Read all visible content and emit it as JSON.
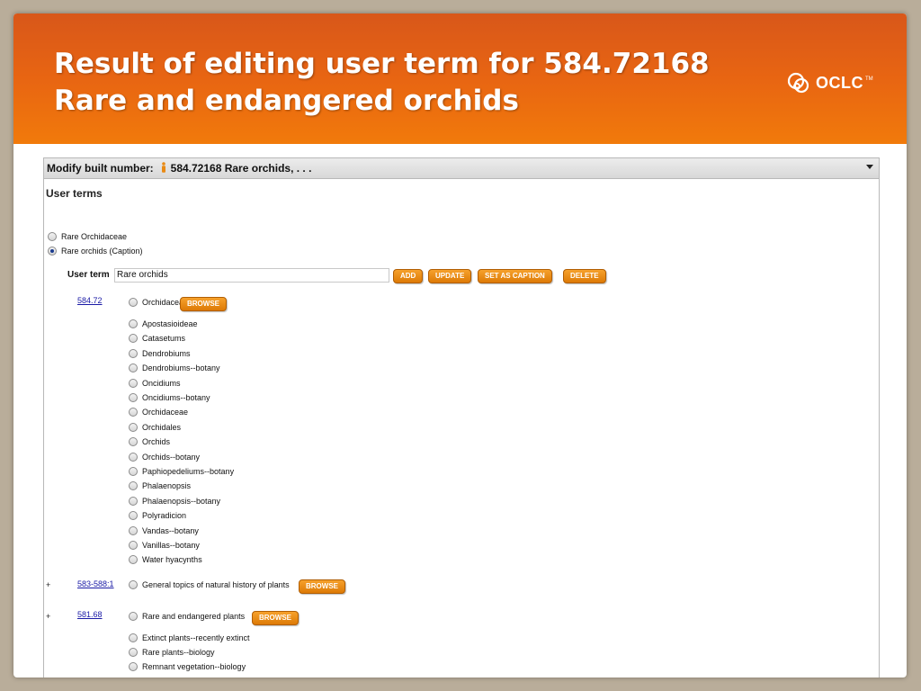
{
  "slide": {
    "title_line1": "Result of editing user term for 584.72168",
    "title_line2": "Rare and endangered orchids",
    "logo_text": "OCLC",
    "logo_tm": "TM"
  },
  "panel": {
    "header_label": "Modify built number:",
    "header_value": "584.72168 Rare orchids, . . .",
    "section_title": "User terms",
    "user_terms": [
      {
        "label": "Rare Orchidaceae",
        "checked": false
      },
      {
        "label": "Rare orchids  (Caption)",
        "checked": true
      }
    ],
    "user_term_label": "User term",
    "user_term_value": "Rare orchids",
    "buttons": {
      "add": "ADD",
      "update": "UPDATE",
      "set_as_caption": "SET AS CAPTION",
      "delete": "DELETE",
      "browse": "BROWSE"
    },
    "groups": [
      {
        "number": "584.72",
        "plus": "",
        "heading": "Orchidaceae",
        "terms": [
          "Apostasioideae",
          "Catasetums",
          "Dendrobiums",
          "Dendrobiums--botany",
          "Oncidiums",
          "Oncidiums--botany",
          "Orchidaceae",
          "Orchidales",
          "Orchids",
          "Orchids--botany",
          "Paphiopedeliums--botany",
          "Phalaenopsis",
          "Phalaenopsis--botany",
          "Polyradicion",
          "Vandas--botany",
          "Vanillas--botany",
          "Water hyacynths"
        ]
      },
      {
        "number": "583-588:1",
        "plus": "+",
        "heading": "General topics of natural history of plants",
        "terms": []
      },
      {
        "number": "581.68",
        "plus": "+",
        "heading": "Rare and endangered plants",
        "terms": [
          "Extinct plants--recently extinct",
          "Rare plants--biology",
          "Remnant vegetation--biology"
        ]
      }
    ]
  },
  "colors": {
    "banner_orange": "#e86512",
    "button_orange": "#e8890f",
    "link_blue": "#1a1aa6"
  }
}
